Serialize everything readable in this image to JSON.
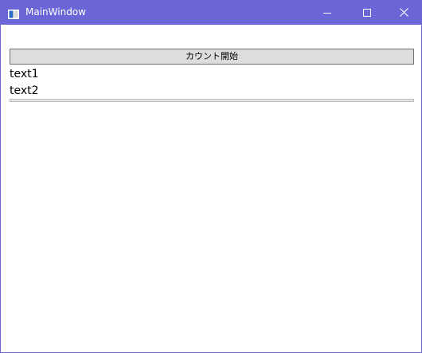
{
  "window": {
    "title": "MainWindow",
    "accent_color": "#6a66d8",
    "controls": [
      "minimize-icon",
      "maximize-icon",
      "close-icon"
    ]
  },
  "main": {
    "start_button_label": "カウント開始",
    "text1": "text1",
    "text2": "text2",
    "progress": 0
  }
}
